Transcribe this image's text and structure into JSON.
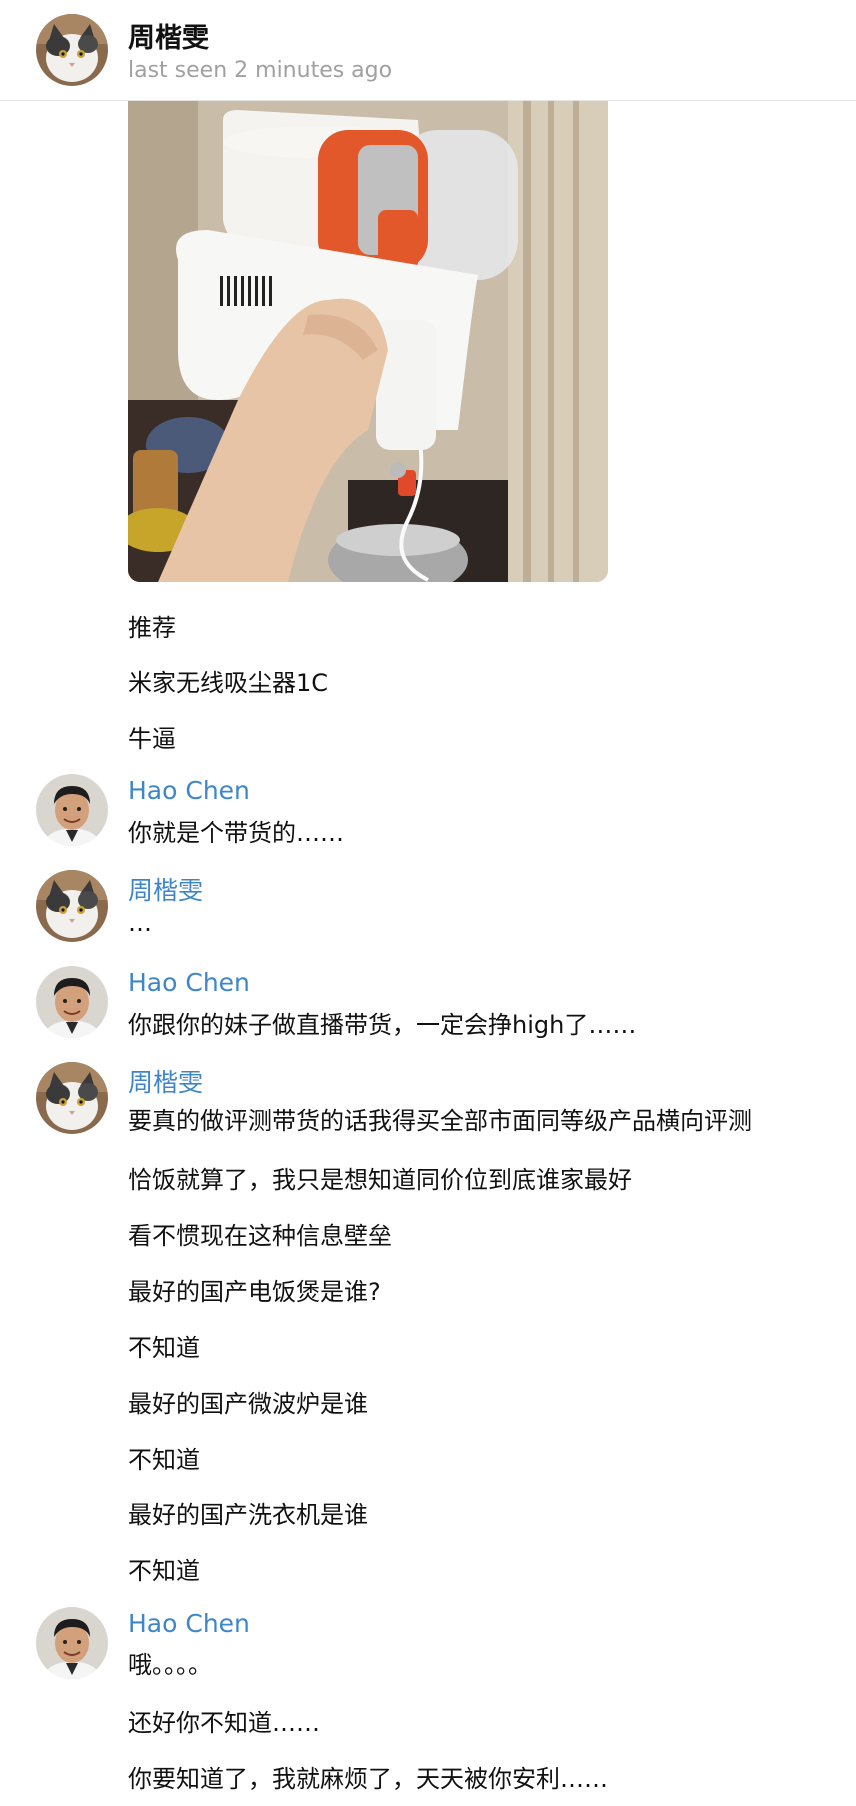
{
  "header": {
    "title": "周楷雯",
    "status": "last seen 2 minutes ago",
    "avatar_icon": "cat-avatar-icon"
  },
  "colors": {
    "sender_name": "#3f86c9",
    "status_text": "#a0a0a0",
    "background": "#ffffff"
  },
  "messages": {
    "m1": "推荐",
    "m2": "米家无线吸尘器1C",
    "m3": "牛逼",
    "g2_sender": "Hao Chen",
    "m4": "你就是个带货的……",
    "g3_sender": "周楷雯",
    "m5": "…",
    "g4_sender": "Hao Chen",
    "m6": "你跟你的妹子做直播带货，一定会挣high了……",
    "g5_sender": "周楷雯",
    "m7": "要真的做评测带货的话我得买全部市面同等级产品横向评测",
    "m8": "恰饭就算了，我只是想知道同价位到底谁家最好",
    "m9": "看不惯现在这种信息壁垒",
    "m10": "最好的国产电饭煲是谁?",
    "m11": "不知道",
    "m12": "最好的国产微波炉是谁",
    "m13": "不知道",
    "m14": "最好的国产洗衣机是谁",
    "m15": "不知道",
    "g6_sender": "Hao Chen",
    "m16": "哦。。。。",
    "m17": "还好你不知道……",
    "m18": "你要知道了，我就麻烦了，天天被你安利……"
  }
}
